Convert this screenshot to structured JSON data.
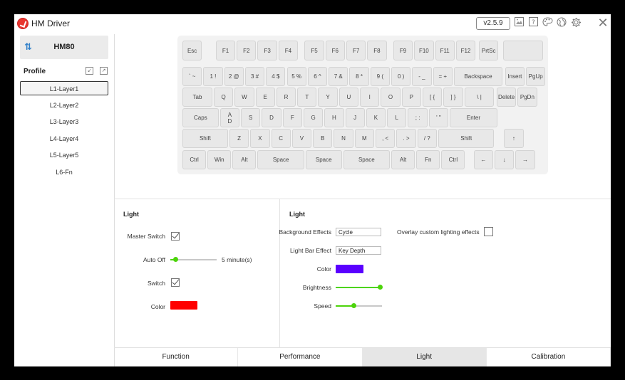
{
  "titlebar": {
    "title": "HM Driver",
    "version": "v2.5.9",
    "icons": [
      "image-icon",
      "help-icon",
      "palette-icon",
      "globe-icon",
      "gear-icon"
    ],
    "close": "✕"
  },
  "sidebar": {
    "device_name": "HM80",
    "profile_label": "Profile",
    "layers": [
      "L1-Layer1",
      "L2-Layer2",
      "L3-Layer3",
      "L4-Layer4",
      "L5-Layer5",
      "L6-Fn"
    ],
    "active_layer": 0
  },
  "keyboard": {
    "rows": [
      [
        "Esc",
        "F1",
        "F2",
        "F3",
        "F4",
        "F5",
        "F6",
        "F7",
        "F8",
        "F9",
        "F10",
        "F11",
        "F12",
        "PrtSc",
        ""
      ],
      [
        "` ~",
        "1 !",
        "2 @",
        "3 #",
        "4 $",
        "5 %",
        "6 ^",
        "7 &",
        "8 *",
        "9 (",
        "0 )",
        "- _",
        "= +",
        "Backspace",
        "Insert",
        "PgUp"
      ],
      [
        "Tab",
        "Q",
        "W",
        "E",
        "R",
        "T",
        "Y",
        "U",
        "I",
        "O",
        "P",
        "[ {",
        "] }",
        "\\ |",
        "Delete",
        "PgDn"
      ],
      [
        "Caps",
        "A\nD",
        "S",
        "D",
        "F",
        "G",
        "H",
        "J",
        "K",
        "L",
        "; :",
        "' \"",
        "Enter"
      ],
      [
        "Shift",
        "Z",
        "X",
        "C",
        "V",
        "B",
        "N",
        "M",
        ", <",
        ". >",
        "/ ?",
        "Shift",
        "↑"
      ],
      [
        "Ctrl",
        "Win",
        "Alt",
        "Space",
        "Space",
        "Space",
        "Alt",
        "Fn",
        "Ctrl",
        "←",
        "↓",
        "→"
      ]
    ]
  },
  "light_left": {
    "title": "Light",
    "master_switch_label": "Master Switch",
    "master_switch": true,
    "auto_off_label": "Auto Off",
    "auto_off_value": "5 minute(s)",
    "auto_off_level": 0.1,
    "switch_label": "Switch",
    "switch": true,
    "color_label": "Color",
    "color": "#ff0000"
  },
  "light_right": {
    "title": "Light",
    "background_effects_label": "Background Effects",
    "background_effects": "Cycle",
    "light_bar_effect_label": "Light Bar Effect",
    "light_bar_effect": "Key Depth",
    "color_label": "Color",
    "color": "#5a00ff",
    "brightness_label": "Brightness",
    "brightness_level": 0.95,
    "speed_label": "Speed",
    "speed_level": 0.38,
    "overlay_label": "Overlay custom lighting effects",
    "overlay": false
  },
  "tabs": [
    "Function",
    "Performance",
    "Light",
    "Calibration"
  ],
  "active_tab": 2,
  "colors": {
    "accent_green": "#4cd40a",
    "logo_red": "#e8362f",
    "device_icon": "#2f7fc9"
  }
}
